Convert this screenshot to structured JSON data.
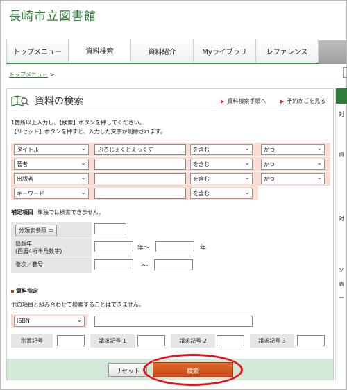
{
  "site": {
    "title": "長崎市立図書館"
  },
  "nav": {
    "tabs": [
      "トップメニュー",
      "資料検索",
      "資料紹介",
      "Myライブラリ",
      "レファレンス"
    ],
    "active_index": 1
  },
  "breadcrumb": {
    "home": "トップメニュー",
    "sep": ">"
  },
  "search": {
    "title": "資料の検索",
    "links": {
      "procedure": "資料検索手順へ",
      "cart": "予約かごを見る"
    },
    "instructions": [
      "1箇所以上入力し、【検索】ボタンを押してください。",
      "【リセット】ボタンを押すと、入力した文字が削除されます。"
    ],
    "conditions": [
      {
        "field": "タイトル",
        "value": "ぶろじぇくとえっくす",
        "match": "を含む",
        "op": "かつ"
      },
      {
        "field": "著者",
        "value": "",
        "match": "を含む",
        "op": "かつ"
      },
      {
        "field": "出版者",
        "value": "",
        "match": "を含む",
        "op": "かつ"
      },
      {
        "field": "キーワード",
        "value": "",
        "match": "を含む",
        "op": null
      }
    ],
    "supplement": {
      "heading": "補足項目",
      "note": "単独では検索できません。",
      "classification_button": "分類表参照",
      "pub_year_label_1": "出版年",
      "pub_year_label_2": "(西暦4桁半角数字)",
      "year_from_unit": "年〜",
      "year_to_unit": "年",
      "volume_label": "巻次／巻号",
      "tilde": "〜"
    },
    "material": {
      "heading": "資料指定",
      "note": "他の項目と組み合わせて検索することはできません。",
      "id_type": "ISBN",
      "id_value": "",
      "labels": [
        "別置記号",
        "請求記号 1",
        "請求記号 2",
        "請求記号 3"
      ]
    },
    "buttons": {
      "reset": "リセット",
      "search": "検索"
    }
  },
  "right_column": {
    "chars": [
      "対",
      "資",
      "対",
      "ソ",
      "表",
      "ー"
    ]
  },
  "colors": {
    "brand_green": "#2e7d3a",
    "search_orange": "#c4471a",
    "highlight_red": "#e4141e",
    "condition_bg": "#f9ddd2"
  }
}
